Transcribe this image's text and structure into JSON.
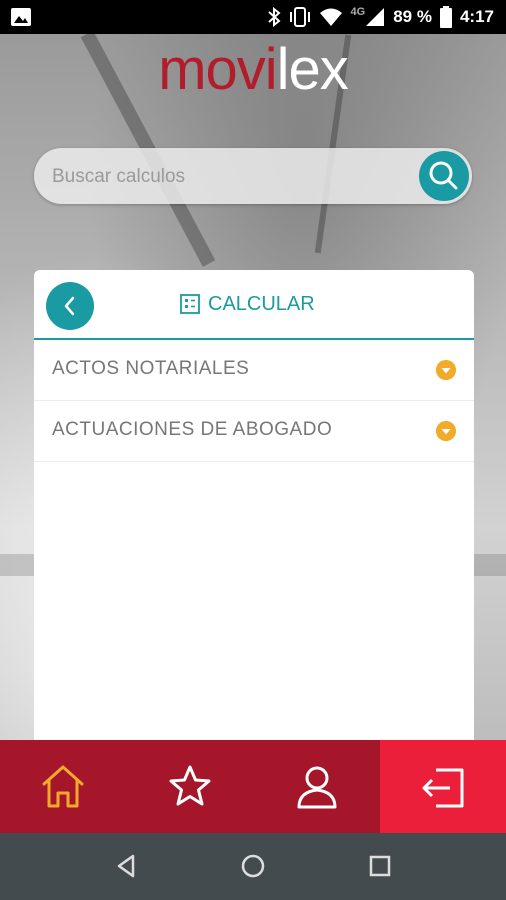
{
  "status_bar": {
    "network": "4G",
    "battery": "89 %",
    "time": "4:17",
    "icons": [
      "image-icon",
      "bluetooth-icon",
      "vibrate-icon",
      "wifi-icon",
      "signal-icon",
      "battery-icon"
    ]
  },
  "brand": {
    "part1": "movi",
    "part2": "lex",
    "color_primary": "#b11d2c"
  },
  "search": {
    "placeholder": "Buscar calculos",
    "icon": "search-icon"
  },
  "card": {
    "title": "CALCULAR",
    "title_icon": "calculator-icon",
    "back_icon": "chevron-left-icon",
    "items": [
      {
        "label": "ACTOS NOTARIALES",
        "icon": "chevron-down-icon"
      },
      {
        "label": "ACTUACIONES DE ABOGADO",
        "icon": "chevron-down-icon"
      }
    ]
  },
  "bottom_nav": {
    "items": [
      {
        "name": "home",
        "icon": "home-icon"
      },
      {
        "name": "favorites",
        "icon": "star-icon"
      },
      {
        "name": "profile",
        "icon": "user-icon"
      },
      {
        "name": "logout",
        "icon": "logout-icon"
      }
    ]
  },
  "colors": {
    "accent": "#1a9aa2",
    "nav_bg": "#a5162a",
    "exit_bg": "#ec1f3a",
    "chevron": "#f2aa2a",
    "home_active": "#f2aa2a"
  }
}
